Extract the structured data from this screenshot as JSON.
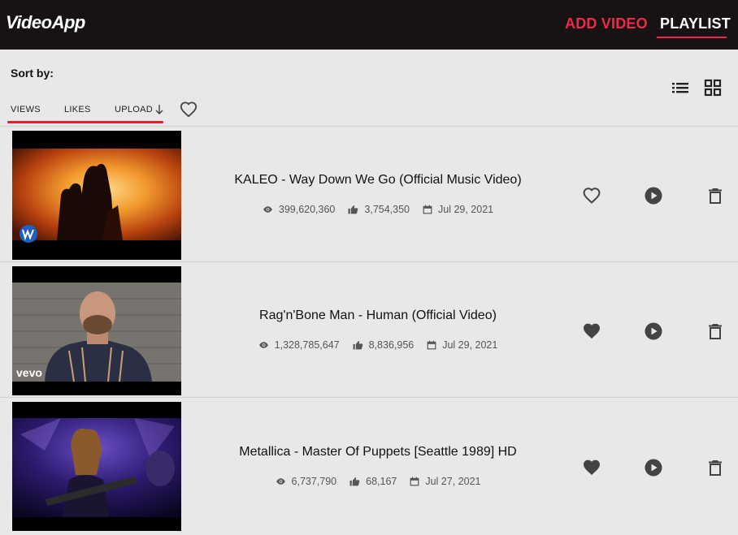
{
  "app": {
    "logo": "VideoApp"
  },
  "nav": {
    "add_video": "ADD VIDEO",
    "playlist": "PLAYLIST"
  },
  "sort": {
    "label": "Sort by:",
    "options": [
      "VIEWS",
      "LIKES",
      "UPLOAD"
    ],
    "active": "UPLOAD",
    "direction_icon": "arrow-down-icon",
    "favorites_filter_icon": "heart-outline-icon"
  },
  "view_modes": {
    "list_icon": "list-icon",
    "grid_icon": "grid-icon"
  },
  "colors": {
    "accent": "#f0284a",
    "topbar": "#161312",
    "background": "#e8e8e8"
  },
  "videos": [
    {
      "title": "KALEO - Way Down We Go (Official Music Video)",
      "views": "399,620,360",
      "likes": "3,754,350",
      "date": "Jul 29, 2021",
      "favorite": false,
      "thumb_badge": "warner-logo-icon"
    },
    {
      "title": "Rag'n'Bone Man - Human (Official Video)",
      "views": "1,328,785,647",
      "likes": "8,836,956",
      "date": "Jul 29, 2021",
      "favorite": true,
      "thumb_badge": "vevo"
    },
    {
      "title": "Metallica - Master Of Puppets [Seattle 1989] HD",
      "views": "6,737,790",
      "likes": "68,167",
      "date": "Jul 27, 2021",
      "favorite": true,
      "thumb_badge": ""
    }
  ]
}
